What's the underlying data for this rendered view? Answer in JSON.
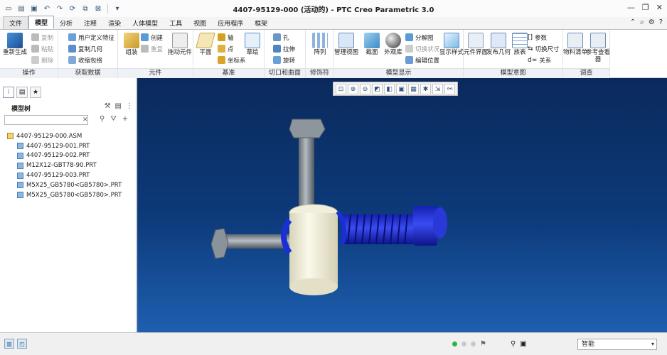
{
  "window": {
    "title": "4407-95129-000 (活动的) - PTC Creo Parametric 3.0"
  },
  "quick_access": [
    "new-icon",
    "open-icon",
    "save-icon",
    "undo-icon",
    "redo-icon",
    "regenerate-icon",
    "windows-icon",
    "close-icon",
    "more-icon"
  ],
  "tabs": [
    "文件",
    "模型",
    "分析",
    "注释",
    "渲染",
    "人体模型",
    "工具",
    "视图",
    "应用程序",
    "框架"
  ],
  "ribbon": {
    "groups": [
      {
        "label": "操作"
      },
      {
        "label": "获取数据"
      },
      {
        "label": "元件"
      },
      {
        "label": "基准"
      },
      {
        "label": "切口和曲面"
      },
      {
        "label": "修饰符"
      },
      {
        "label": "模型显示"
      },
      {
        "label": "模型意图"
      },
      {
        "label": "调查"
      }
    ],
    "ops": {
      "regenerate": "重新生成",
      "copy": "复制",
      "paste": "粘贴",
      "delete": "删除"
    },
    "getdata": {
      "udf": "用户定义特征",
      "copy_geom": "复制几何",
      "shrinkwrap": "收缩包络"
    },
    "component": {
      "assemble": "组装",
      "create": "创建",
      "repeat": "重复",
      "drag": "拖动元件"
    },
    "datum": {
      "plane": "平面",
      "axis": "轴",
      "point": "点",
      "csys": "坐标系",
      "sketch": "草绘"
    },
    "cut": {
      "hole": "孔",
      "extrude": "拉伸",
      "revolve": "旋转"
    },
    "modifier": {
      "pattern": "阵列"
    },
    "display": {
      "manage_views": "管理视图",
      "section": "截面",
      "appearance": "外观库",
      "exploded": "分解图",
      "toggle_state": "切换状况",
      "edit_position": "编辑位置",
      "display_style": "显示样式"
    },
    "intent": {
      "component_interface": "元件界面",
      "publish_geom": "发布几何",
      "family_table": "族表",
      "parameters": "参数",
      "switch_dims": "切换尺寸",
      "relations": "关系"
    },
    "investigate": {
      "bom": "物料清单",
      "ref_viewer": "参考查看器"
    }
  },
  "model_tree": {
    "header": "模型树",
    "root": "4407-95129-000.ASM",
    "items": [
      "4407-95129-001.PRT",
      "4407-95129-002.PRT",
      "M12X12-GBT78-90.PRT",
      "4407-95129-003.PRT",
      "M5X25_GB5780<GB5780>.PRT",
      "M5X25_GB5780<GB5780>.PRT"
    ]
  },
  "status": {
    "filter": "智能"
  },
  "colors": {
    "viewport_top": "#0a2a5c",
    "viewport_bottom": "#1e5fb0",
    "part_blue": "#1a2fd6",
    "part_cream": "#f3f0dc",
    "part_gray": "#7f8a94"
  }
}
